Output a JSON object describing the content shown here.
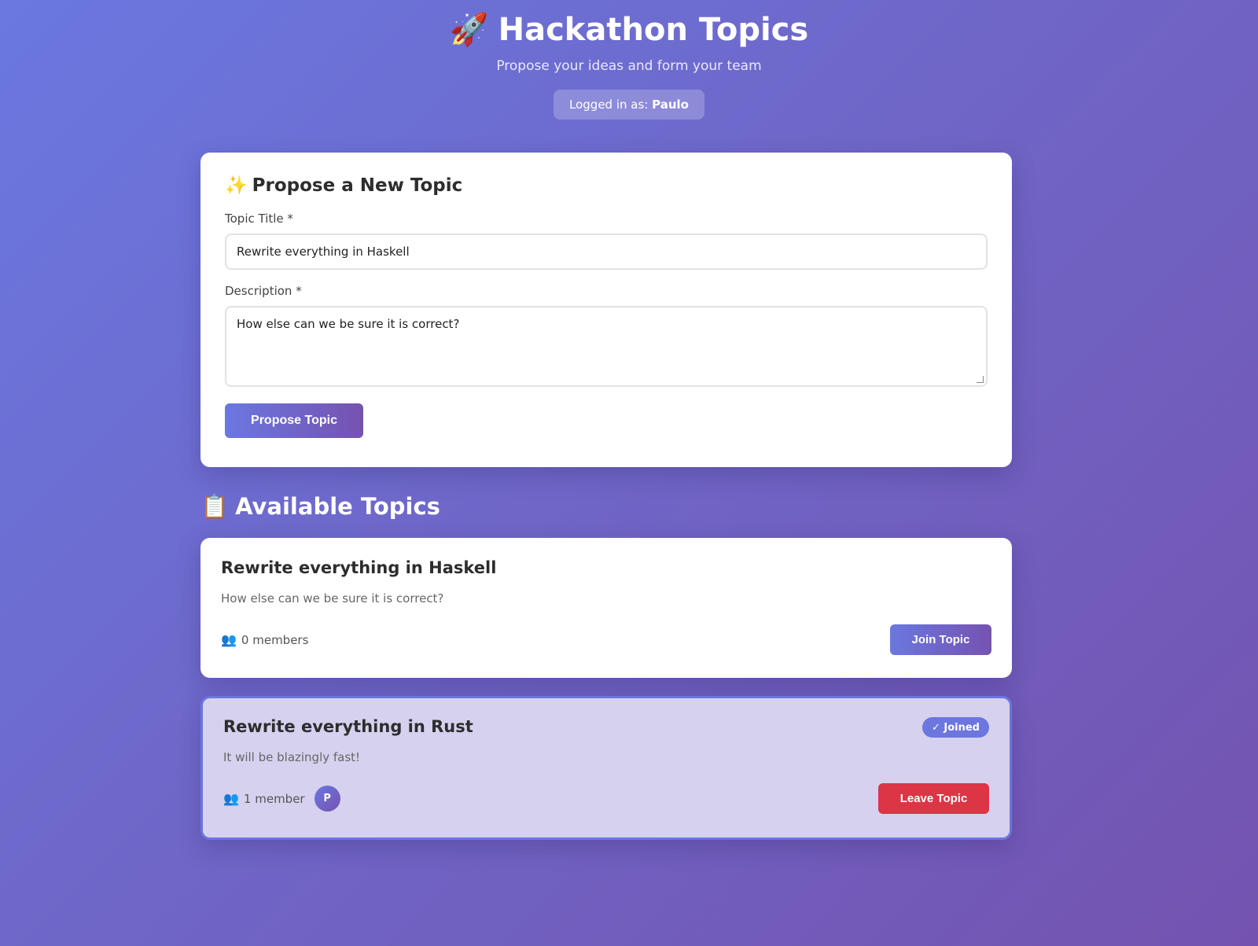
{
  "header": {
    "title": "Hackathon Topics",
    "title_icon": "🚀",
    "subtitle": "Propose your ideas and form your team",
    "logged_in_label": "Logged in as:",
    "username": "Paulo"
  },
  "propose": {
    "heading_icon": "✨",
    "heading": "Propose a New Topic",
    "title_label": "Topic Title *",
    "title_value": "Rewrite everything in Haskell",
    "description_label": "Description *",
    "description_value": "How else can we be sure it is correct?",
    "submit_label": "Propose Topic"
  },
  "topics_section": {
    "heading_icon": "📋",
    "heading": "Available Topics"
  },
  "topics": [
    {
      "title": "Rewrite everything in Haskell",
      "description": "How else can we be sure it is correct?",
      "members_icon": "👥",
      "members_text": "0 members",
      "action_label": "Join Topic",
      "joined": false
    },
    {
      "title": "Rewrite everything in Rust",
      "description": "It will be blazingly fast!",
      "members_icon": "👥",
      "members_text": "1 member",
      "avatar_initial": "P",
      "badge_label": "✓ Joined",
      "action_label": "Leave Topic",
      "joined": true
    }
  ],
  "colors": {
    "accent_start": "#6a78e0",
    "accent_end": "#7652b0",
    "danger": "#dc3545",
    "joined_bg": "#d6d1ee"
  }
}
